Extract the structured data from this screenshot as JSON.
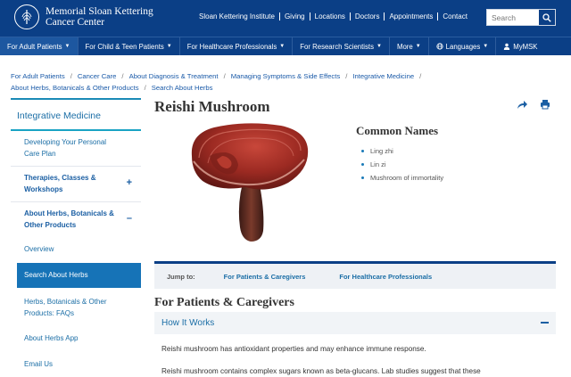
{
  "header": {
    "logo_line1": "Memorial Sloan Kettering",
    "logo_line2": "Cancer Center",
    "util_links": [
      "Sloan Kettering Institute",
      "Giving",
      "Locations",
      "Doctors",
      "Appointments",
      "Contact"
    ],
    "search_placeholder": "Search"
  },
  "nav": {
    "items": [
      {
        "label": "For Adult Patients",
        "caret": "▼"
      },
      {
        "label": "For Child & Teen Patients",
        "caret": "▼"
      },
      {
        "label": "For Healthcare Professionals",
        "caret": "▼"
      },
      {
        "label": "For Research Scientists",
        "caret": "▼"
      },
      {
        "label": "More",
        "caret": "▼"
      },
      {
        "label": "Languages",
        "caret": "▼"
      },
      {
        "label": "MyMSK",
        "caret": ""
      }
    ]
  },
  "breadcrumb": {
    "items": [
      "For Adult Patients",
      "Cancer Care",
      "About Diagnosis & Treatment",
      "Managing Symptoms & Side Effects",
      "Integrative Medicine",
      "About Herbs, Botanicals & Other Products",
      "Search About Herbs"
    ],
    "separator": "/"
  },
  "sidebar": {
    "title": "Integrative Medicine",
    "items": [
      {
        "label": "Developing Your Personal Care Plan",
        "toggle": ""
      },
      {
        "label": "Therapies, Classes & Workshops",
        "toggle": "+"
      },
      {
        "label": "About Herbs, Botanicals & Other Products",
        "toggle": "–"
      }
    ],
    "subitems": [
      "Overview",
      "Search About Herbs",
      "Herbs, Botanicals & Other Products: FAQs",
      "About Herbs App",
      "Email Us"
    ]
  },
  "content": {
    "title": "Reishi Mushroom",
    "common_names_title": "Common Names",
    "common_names": [
      "Ling zhi",
      "Lin zi",
      "Mushroom of immortality"
    ],
    "jump_label": "Jump to:",
    "jump_links": [
      "For Patients & Caregivers",
      "For Healthcare Professionals"
    ],
    "section_title": "For Patients & Caregivers",
    "accordion_title": "How It Works",
    "paragraph1": "Reishi mushroom has antioxidant properties and may enhance immune response.",
    "paragraph2": "Reishi mushroom contains complex sugars known as beta-glucans. Lab studies suggest that these"
  },
  "colors": {
    "brand_navy": "#0b3f86",
    "link_blue": "#1b6ea6",
    "selected_blue": "#1673b7"
  }
}
